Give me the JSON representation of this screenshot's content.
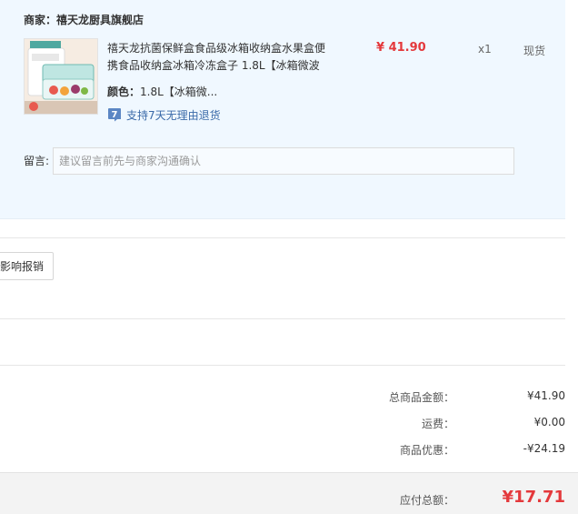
{
  "order": {
    "shop_label": "商家：",
    "shop_name": "禧天龙厨具旗舰店",
    "product": {
      "title": "禧天龙抗菌保鲜盒食品级冰箱收纳盒水果盒便携食品收纳盒冰箱冷冻盒子 1.8L【冰箱微波",
      "image_icon": "food-storage-box-image",
      "price": "¥ 41.90",
      "quantity": "x1",
      "stock_status": "现货",
      "spec_label": "颜色：",
      "spec_value": "1.8L【冰箱微...",
      "return_policy": "支持7天无理由退货",
      "return_icon": "seven-day-return-icon"
    },
    "remark": {
      "label": "留言:",
      "placeholder": "建议留言前先与商家沟通确认"
    }
  },
  "invoice": {
    "button_label": "影响报销"
  },
  "summary": {
    "items_total_label": "总商品金额：",
    "items_total_value": "¥41.90",
    "shipping_label": "运费：",
    "shipping_value": "¥0.00",
    "discount_label": "商品优惠：",
    "discount_value": "-¥24.19",
    "payable_label": "应付总额：",
    "payable_value": "¥17.71"
  },
  "colors": {
    "price_red": "#e4393c",
    "panel_bg": "#f0f8ff",
    "link_blue": "#3a6aa8"
  }
}
